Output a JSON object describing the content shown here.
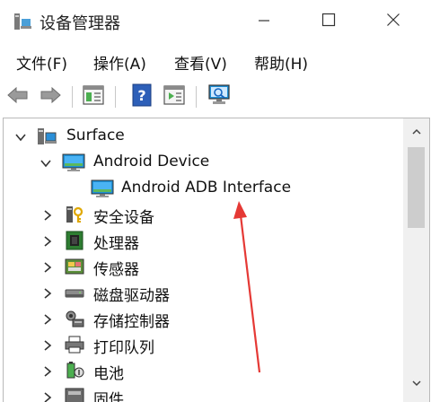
{
  "window": {
    "title": "设备管理器",
    "icon": "device-manager-icon"
  },
  "window_controls": {
    "minimize_icon": "minimize-icon",
    "maximize_icon": "maximize-icon",
    "close_icon": "close-icon"
  },
  "menu": {
    "items": [
      {
        "label": "文件(F)"
      },
      {
        "label": "操作(A)"
      },
      {
        "label": "查看(V)"
      },
      {
        "label": "帮助(H)"
      }
    ]
  },
  "toolbar": {
    "buttons": [
      {
        "icon": "back-arrow-icon"
      },
      {
        "icon": "forward-arrow-icon"
      },
      {
        "icon": "properties-icon"
      },
      {
        "icon": "help-icon"
      },
      {
        "icon": "update-driver-icon"
      },
      {
        "icon": "scan-hardware-icon"
      }
    ]
  },
  "tree": {
    "nodes": [
      {
        "label": "Surface",
        "icon": "computer-icon",
        "expanded": true,
        "level": 0
      },
      {
        "label": "Android Device",
        "icon": "monitor-icon",
        "expanded": true,
        "level": 1
      },
      {
        "label": "Android ADB Interface",
        "icon": "monitor-icon",
        "expanded": null,
        "level": 2
      },
      {
        "label": "安全设备",
        "icon": "security-key-icon",
        "expanded": false,
        "level": 1
      },
      {
        "label": "处理器",
        "icon": "chip-icon",
        "expanded": false,
        "level": 1
      },
      {
        "label": "传感器",
        "icon": "sensor-icon",
        "expanded": false,
        "level": 1
      },
      {
        "label": "磁盘驱动器",
        "icon": "disk-drive-icon",
        "expanded": false,
        "level": 1
      },
      {
        "label": "存储控制器",
        "icon": "storage-controller-icon",
        "expanded": false,
        "level": 1
      },
      {
        "label": "打印队列",
        "icon": "printer-icon",
        "expanded": false,
        "level": 1
      },
      {
        "label": "电池",
        "icon": "battery-icon",
        "expanded": false,
        "level": 1
      },
      {
        "label": "固件",
        "icon": "firmware-icon",
        "expanded": false,
        "level": 1
      }
    ]
  },
  "colors": {
    "annotation_arrow": "#e53935",
    "monitor_screen": "#1e8fd6",
    "monitor_green": "#5cb85c"
  }
}
